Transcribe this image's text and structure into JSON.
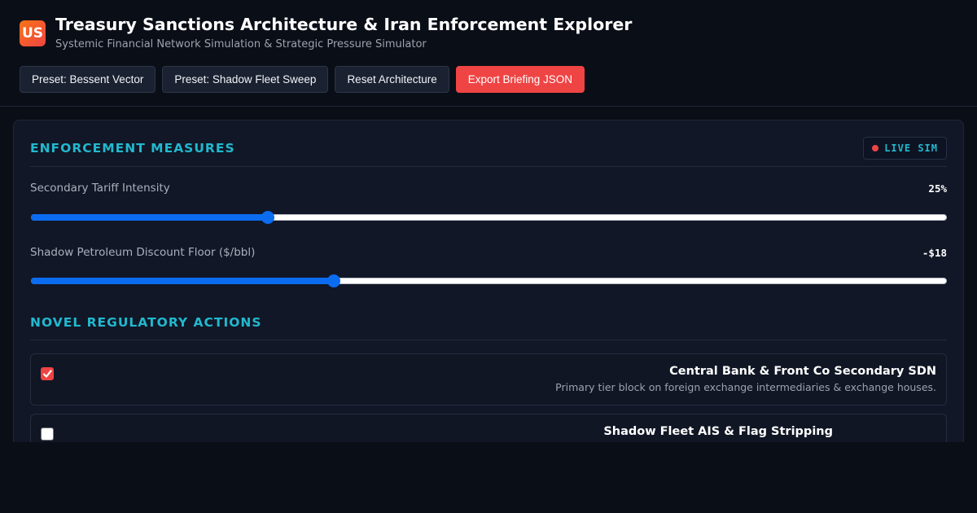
{
  "header": {
    "logo_text": "US",
    "title": "Treasury Sanctions Architecture & Iran Enforcement Explorer",
    "subtitle": "Systemic Financial Network Simulation & Strategic Pressure Simulator",
    "buttons": [
      {
        "label": "Preset: Bessent Vector"
      },
      {
        "label": "Preset: Shadow Fleet Sweep"
      },
      {
        "label": "Reset Architecture"
      },
      {
        "label": "Export Briefing JSON"
      }
    ]
  },
  "enforcement": {
    "title": "ENFORCEMENT MEASURES",
    "badge": "LIVE SIM",
    "sliders": [
      {
        "label": "Secondary Tariff Intensity",
        "value_text": "25%",
        "fraction": 0.258
      },
      {
        "label": "Shadow Petroleum Discount Floor ($/bbl)",
        "value_text": "-$18",
        "fraction": 0.33
      }
    ]
  },
  "regulatory": {
    "title": "NOVEL REGULATORY ACTIONS",
    "actions": [
      {
        "title": "Central Bank & Front Co Secondary SDN",
        "description": "Primary tier block on foreign exchange intermediaries & exchange houses.",
        "checked": true
      },
      {
        "title": "Shadow Fleet AIS & Flag Stripping",
        "description": "",
        "checked": false
      }
    ]
  },
  "colors": {
    "accent": "#22b8cf",
    "danger": "#ef4444",
    "slider": "#0b6cf0",
    "background": "#0a0e17",
    "panel": "#111726"
  }
}
